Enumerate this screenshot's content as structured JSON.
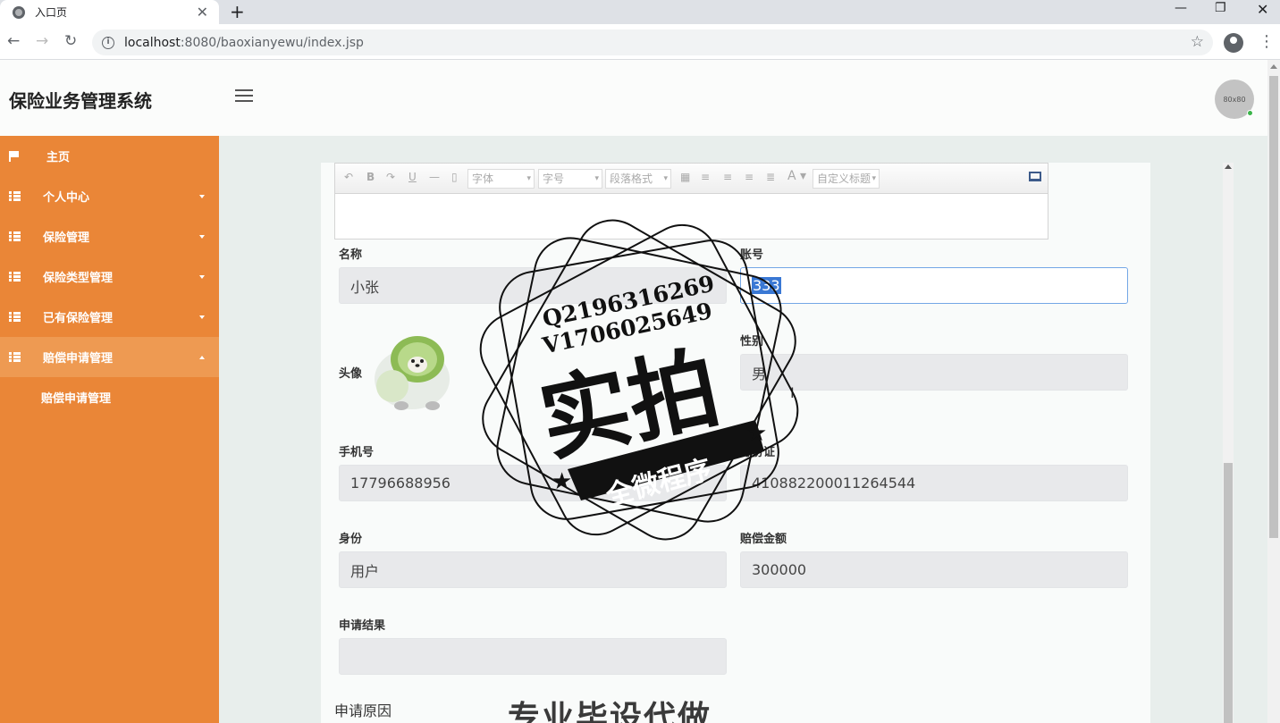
{
  "browser": {
    "tab_title": "入口页",
    "url_host": "localhost",
    "url_path": ":8080/baoxianyewu/index.jsp"
  },
  "header": {
    "app_title": "保险业务管理系统",
    "avatar_text": "80x80"
  },
  "sidebar": {
    "items": [
      {
        "label": "主页",
        "icon": "flag-icon"
      },
      {
        "label": "个人中心",
        "icon": "grid-icon"
      },
      {
        "label": "保险管理",
        "icon": "grid-icon"
      },
      {
        "label": "保险类型管理",
        "icon": "grid-icon"
      },
      {
        "label": "已有保险管理",
        "icon": "grid-icon"
      },
      {
        "label": "赔偿申请管理",
        "icon": "grid-icon"
      }
    ],
    "sub_item": "赔偿申请管理"
  },
  "editor": {
    "font_select": "字体",
    "size_select": "字号",
    "paragraph_select": "段落格式",
    "custom_title_select": "自定义标题"
  },
  "form": {
    "name": {
      "label": "名称",
      "value": "小张"
    },
    "account": {
      "label": "账号",
      "value": "333"
    },
    "avatar": {
      "label": "头像"
    },
    "gender": {
      "label": "性别",
      "value": "男"
    },
    "phone": {
      "label": "手机号",
      "value": "17796688956"
    },
    "id_card": {
      "label": "身份证",
      "value": "410882200011264544"
    },
    "role": {
      "label": "身份",
      "value": "用户"
    },
    "amount": {
      "label": "赔偿金额",
      "value": "300000"
    },
    "result": {
      "label": "申请结果",
      "value": ""
    },
    "reason": {
      "label": "申请原因"
    }
  },
  "watermark": {
    "q": "Q2196316269",
    "v": "V1706025649",
    "big": "实拍",
    "banner": "全微程序",
    "bottom": "专业毕设代做"
  },
  "colors": {
    "sidebar": "#ea8637",
    "sidebar_active": "#ee9a52",
    "main_bg": "#e8eeec"
  }
}
